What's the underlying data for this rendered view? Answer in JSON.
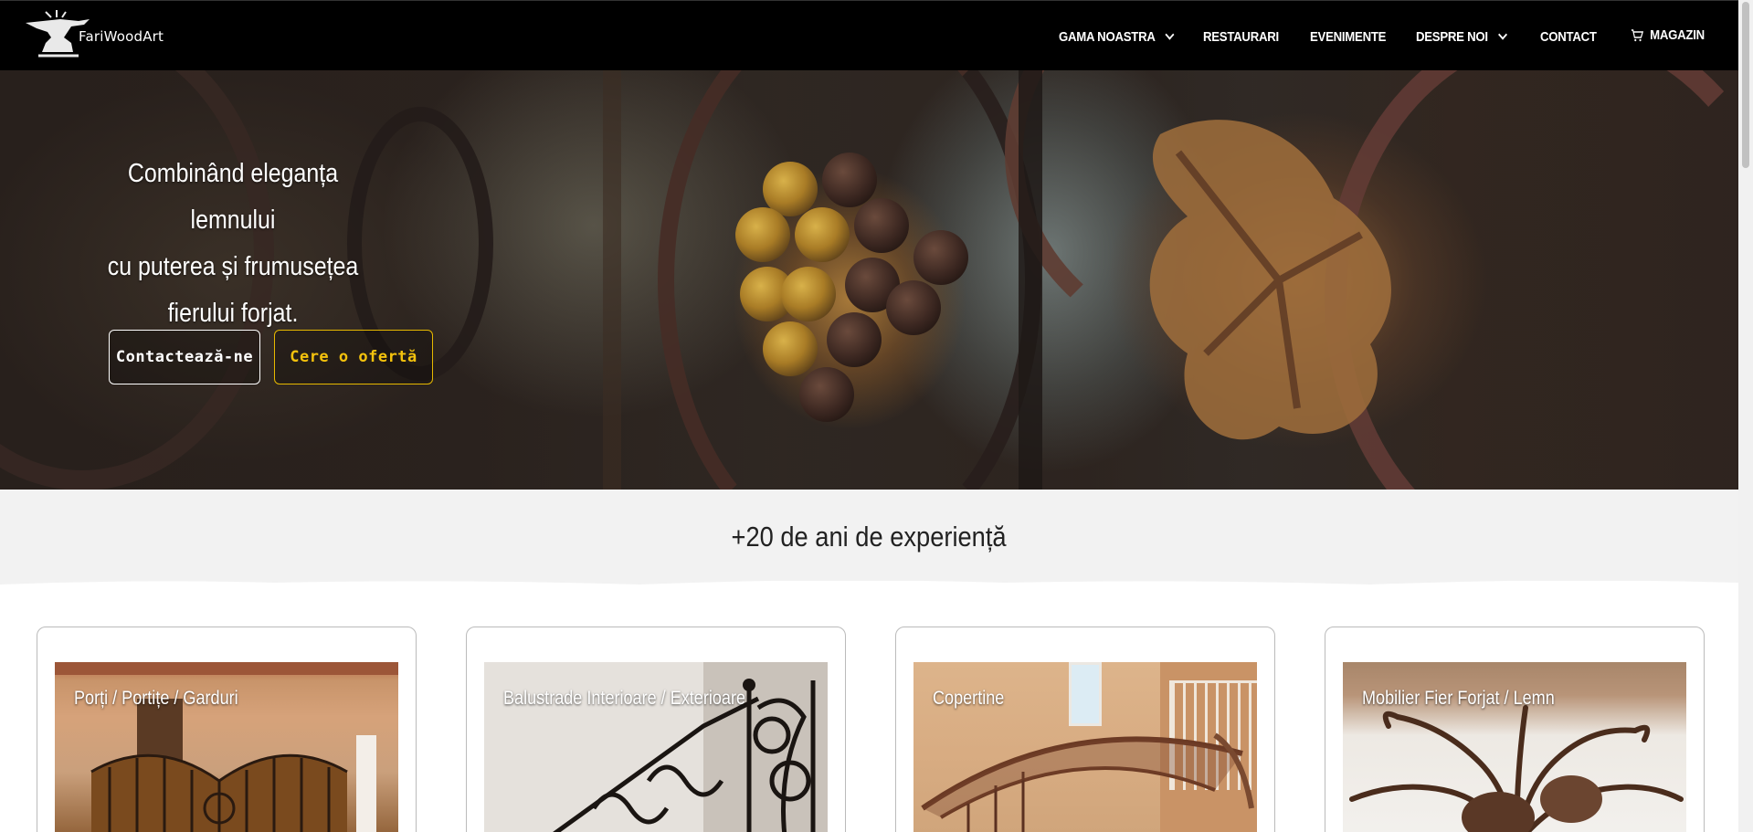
{
  "header": {
    "logo_text": "FariWoodArt",
    "nav": [
      {
        "label": "GAMA NOASTRA",
        "has_dropdown": true
      },
      {
        "label": "RESTAURARI",
        "has_dropdown": false
      },
      {
        "label": "EVENIMENTE",
        "has_dropdown": false
      },
      {
        "label": "DESPRE NOI",
        "has_dropdown": true
      },
      {
        "label": "CONTACT",
        "has_dropdown": false
      },
      {
        "label": "MAGAZIN",
        "has_dropdown": false,
        "icon": "cart-icon"
      }
    ]
  },
  "hero": {
    "line1": "Combinând eleganța lemnului",
    "line2": "cu puterea și frumusețea",
    "line3": "fierului forjat.",
    "contact_button": "Contactează-ne",
    "offer_button": "Cere o ofertă"
  },
  "experience": {
    "title": "+20 de ani de experiență"
  },
  "categories": [
    {
      "label": "Porți / Portițe / Garduri"
    },
    {
      "label": "Balustrade Interioare / Exterioare"
    },
    {
      "label": "Copertine"
    },
    {
      "label": "Mobilier Fier Forjat / Lemn"
    }
  ],
  "colors": {
    "navbar": "#000000",
    "accent": "#f4c20d",
    "page_background": "#f2f2f2"
  }
}
